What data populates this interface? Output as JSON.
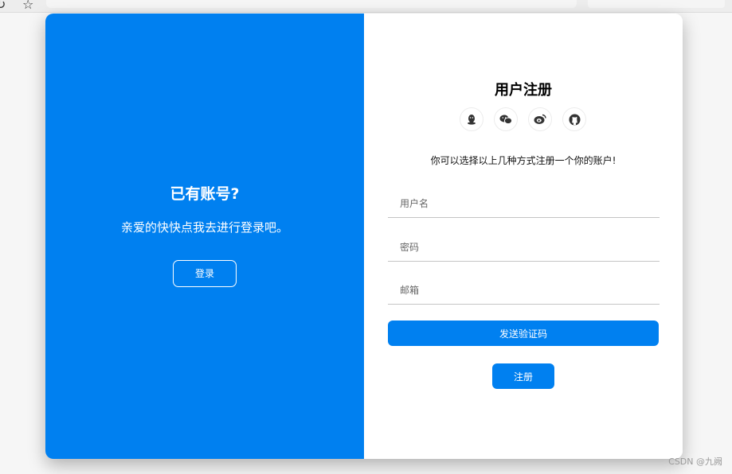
{
  "left": {
    "title": "已有账号?",
    "description": "亲爱的快快点我去进行登录吧。",
    "login_label": "登录"
  },
  "form": {
    "title": "用户注册",
    "socials": [
      "qq-icon",
      "wechat-icon",
      "weibo-icon",
      "github-icon"
    ],
    "hint": "你可以选择以上几种方式注册一个你的账户!",
    "username_placeholder": "用户名",
    "password_placeholder": "密码",
    "email_placeholder": "邮箱",
    "send_code_label": "发送验证码",
    "register_label": "注册"
  },
  "watermark": "CSDN @九阙",
  "colors": {
    "primary": "#0080f0",
    "background": "#f6f6f6"
  }
}
